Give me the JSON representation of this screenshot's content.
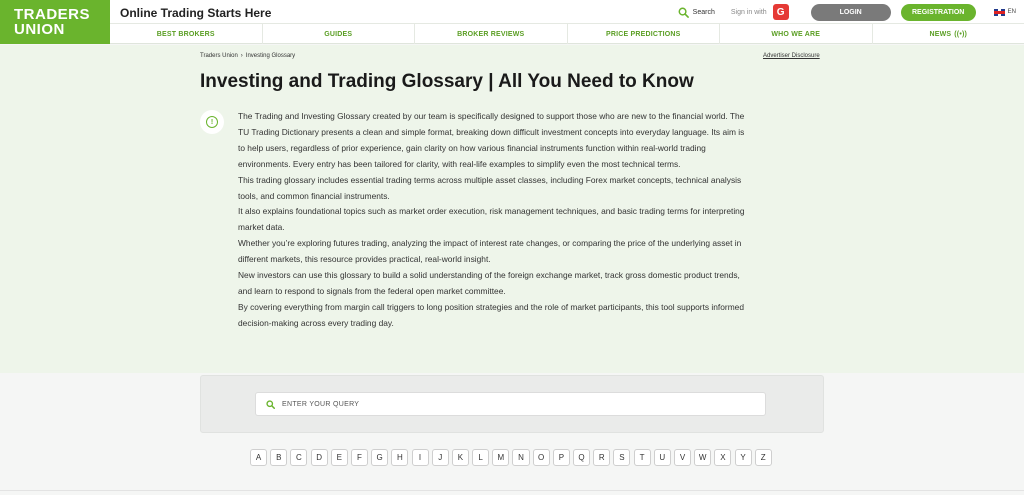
{
  "header": {
    "logo_line1": "TRADERS",
    "logo_line2": "UNION",
    "tagline": "Online Trading Starts Here",
    "search_label": "Search",
    "signin_label": "Sign in with",
    "google_letter": "G",
    "login_label": "LOGIN",
    "register_label": "REGISTRATION",
    "language": "EN",
    "icons": {
      "search": "search-icon",
      "google": "google-icon",
      "flag": "uk-flag-icon",
      "news": "signal-icon"
    },
    "colors": {
      "brand": "#6ab42d",
      "login": "#7a7a7a",
      "google": "#e53935"
    }
  },
  "nav": {
    "items": [
      {
        "label": "BEST BROKERS"
      },
      {
        "label": "GUIDES"
      },
      {
        "label": "BROKER REVIEWS"
      },
      {
        "label": "PRICE PREDICTIONS"
      },
      {
        "label": "WHO WE ARE"
      },
      {
        "label": "NEWS"
      }
    ]
  },
  "breadcrumb": {
    "items": [
      "Traders Union",
      "Investing Glossary"
    ],
    "separator": "›"
  },
  "advertiser_disclosure": "Advertiser Disclosure",
  "page_title": "Investing and Trading Glossary | All You Need to Know",
  "intro_lines": [
    "The Trading and Investing Glossary created by our team is specifically designed to support those who are new to the financial world. The",
    "TU Trading Dictionary presents a clean and simple format, breaking down difficult investment concepts into everyday language. Its aim is",
    "to help users, regardless of prior experience, gain clarity on how various financial instruments function within real-world trading",
    "environments. Every entry has been tailored for clarity, with real-life examples to simplify even the most technical terms.",
    "This trading glossary includes essential trading terms across multiple asset classes, including Forex market concepts, technical analysis",
    "tools, and common financial instruments.",
    "It also explains foundational topics such as market order execution, risk management techniques, and basic trading terms for interpreting",
    "market data.",
    "Whether you’re exploring futures trading, analyzing the impact of interest rate changes, or comparing the price of the underlying asset in",
    "different markets, this resource provides practical, real-world insight.",
    "New investors can use this glossary to build a solid understanding of the foreign exchange market, track gross domestic product trends,",
    "and learn to respond to signals from the federal open market committee.",
    "By covering everything from margin call triggers to long position strategies and the role of market participants, this tool supports informed",
    "decision-making across every trading day."
  ],
  "search": {
    "placeholder": "ENTER YOUR QUERY",
    "value": ""
  },
  "alphabet": [
    "A",
    "B",
    "C",
    "D",
    "E",
    "F",
    "G",
    "H",
    "I",
    "J",
    "K",
    "L",
    "M",
    "N",
    "O",
    "P",
    "Q",
    "R",
    "S",
    "T",
    "U",
    "V",
    "W",
    "X",
    "Y",
    "Z"
  ]
}
